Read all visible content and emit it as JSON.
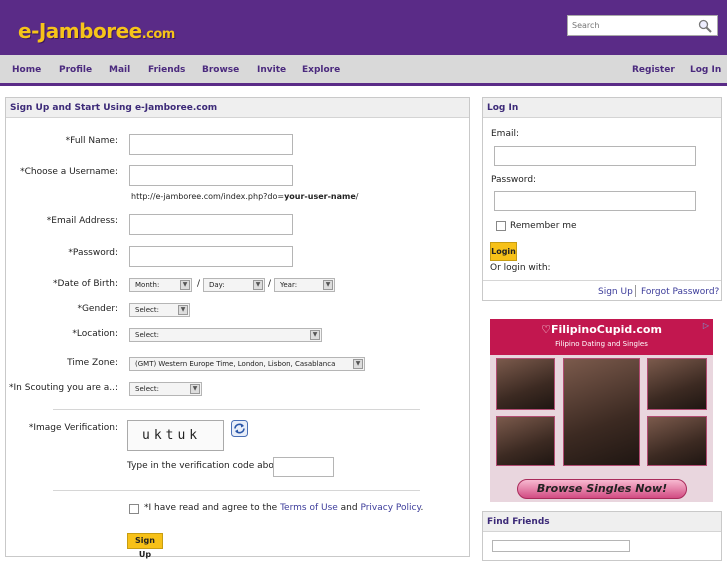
{
  "header": {
    "logo_main": "e-Jamboree",
    "logo_tld": ".com",
    "search_placeholder": "Search",
    "search_icon": "magnifier-icon"
  },
  "nav": {
    "left": [
      "Home",
      "Profile",
      "Mail",
      "Friends",
      "Browse",
      "Invite",
      "Explore"
    ],
    "right": [
      "Register",
      "Log In"
    ],
    "active": "Home"
  },
  "signup": {
    "title": "Sign Up and Start Using e-Jamboree.com",
    "full_name_label": "*Full Name:",
    "username_label": "*Choose a Username:",
    "url_prefix": "http://e-jamboree.com/index.php?do=",
    "url_bold": "your-user-name",
    "url_suffix": "/",
    "email_label": "*Email Address:",
    "password_label": "*Password:",
    "dob_label": "*Date of Birth:",
    "month": "Month:",
    "day": "Day:",
    "year": "Year:",
    "date_sep": "/",
    "gender_label": "*Gender:",
    "gender_value": "Select:",
    "location_label": "*Location:",
    "location_value": "Select:",
    "timezone_label": "Time Zone:",
    "timezone_value": "(GMT) Western Europe Time, London, Lisbon, Casablanca",
    "scouting_label": "*In Scouting you are a..:",
    "scouting_value": "Select:",
    "captcha_label": "*Image Verification:",
    "captcha_text": "uktuk",
    "captcha_prompt": "Type in the verification code above:",
    "agree_prefix": "*I have read and agree to the ",
    "terms_link": "Terms of Use",
    "agree_and": " and ",
    "privacy_link": "Privacy Policy",
    "agree_suffix": ".",
    "signup_button": "Sign Up"
  },
  "login": {
    "title": "Log In",
    "email_label": "Email:",
    "password_label": "Password:",
    "remember_label": "Remember me",
    "login_button": "Login",
    "or_login_with": "Or login with:",
    "signup_link": "Sign Up",
    "forgot_link": "Forgot Password?"
  },
  "ad": {
    "brand": "FilipinoCupid.com",
    "tagline": "Filipino Dating and Singles",
    "button": "Browse Singles Now!"
  },
  "find_friends": {
    "title": "Find Friends"
  },
  "colors": {
    "brand_purple": "#5a2b87",
    "logo_yellow": "#f6c31a",
    "button_yellow": "#f7c118",
    "ad_red": "#c2174f"
  }
}
